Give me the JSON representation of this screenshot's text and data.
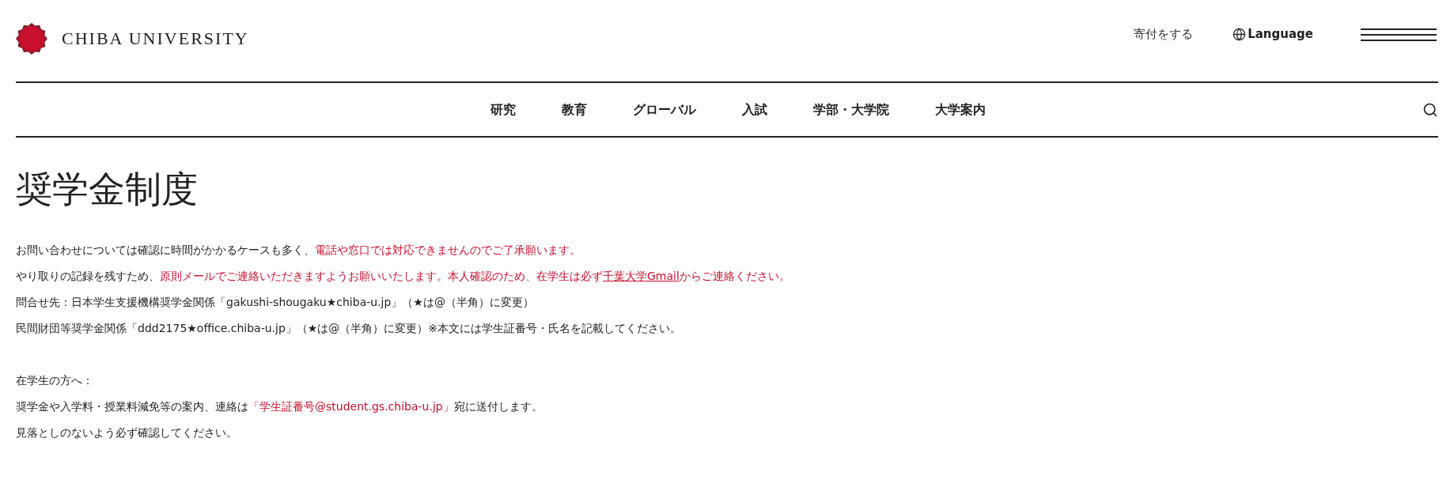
{
  "header": {
    "logo_text": "CHIBA UNIVERSITY",
    "links": [
      {
        "kind": "plain",
        "label": "寄付をする"
      },
      {
        "kind": "language",
        "label": "Language"
      }
    ]
  },
  "nav": [
    "研究",
    "教育",
    "グローバル",
    "入試",
    "学部・大学院",
    "大学案内"
  ],
  "title": "奨学金制度",
  "paragraphs": [
    [
      {
        "kind": "plain",
        "text": "お問い合わせについては確認に時間がかかるケースも多く、"
      },
      {
        "kind": "red",
        "text": "電話や窓口では対応できませんのでご了承願います。"
      }
    ],
    [
      {
        "kind": "plain",
        "text": "やり取りの記録を残すため、"
      },
      {
        "kind": "red",
        "text": "原則メールでご連絡いただきますようお願いいたします。本人確認のため、在学生は必ず"
      },
      {
        "kind": "link",
        "text": "千葉大学Gmail"
      },
      {
        "kind": "red",
        "text": "からご連絡ください。"
      }
    ],
    [
      {
        "kind": "plain",
        "text": "問合せ先：日本学生支援機構奨学金関係「gakushi-shougaku★chiba-u.jp」（★は@（半角）に変更）"
      }
    ],
    [
      {
        "kind": "plain",
        "text": "民間財団等奨学金関係「ddd2175★office.chiba-u.jp」（★は@（半角）に変更）※本文には学生証番号・氏名を記載してください。"
      }
    ],
    [
      {
        "kind": "blank"
      }
    ],
    [
      {
        "kind": "plain",
        "text": "在学生の方へ："
      }
    ],
    [
      {
        "kind": "plain",
        "text": "奨学金や入学料・授業料減免等の案内、連絡は"
      },
      {
        "kind": "red",
        "text": "「学生証番号@student.gs.chiba-u.jp」"
      },
      {
        "kind": "plain",
        "text": "宛に送付します。"
      }
    ],
    [
      {
        "kind": "plain",
        "text": "見落としのないよう必ず確認してください。"
      }
    ]
  ]
}
